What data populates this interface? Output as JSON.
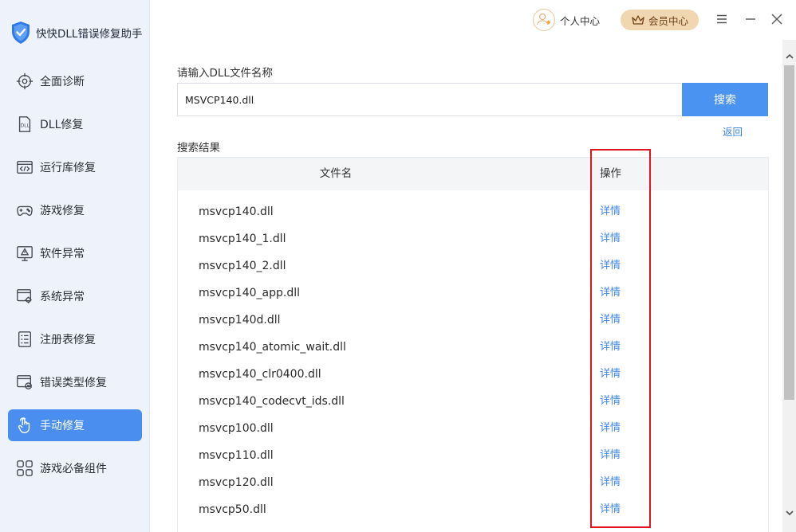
{
  "app": {
    "title": "快快DLL错误修复助手"
  },
  "sidebar": {
    "items": [
      {
        "label": "全面诊断",
        "icon": "target-icon",
        "active": false
      },
      {
        "label": "DLL修复",
        "icon": "dll-file-icon",
        "active": false
      },
      {
        "label": "运行库修复",
        "icon": "code-window-icon",
        "active": false
      },
      {
        "label": "游戏修复",
        "icon": "gamepad-icon",
        "active": false
      },
      {
        "label": "软件异常",
        "icon": "warning-monitor-icon",
        "active": false
      },
      {
        "label": "系统异常",
        "icon": "system-gear-icon",
        "active": false
      },
      {
        "label": "注册表修复",
        "icon": "registry-list-icon",
        "active": false
      },
      {
        "label": "错误类型修复",
        "icon": "error-window-icon",
        "active": false
      },
      {
        "label": "手动修复",
        "icon": "hand-pointer-icon",
        "active": true
      },
      {
        "label": "游戏必备组件",
        "icon": "grid-blocks-icon",
        "active": false
      }
    ]
  },
  "topbar": {
    "user_center": "个人中心",
    "vip_center": "会员中心"
  },
  "search": {
    "label": "请输入DLL文件名称",
    "value": "MSVCP140.dll",
    "button": "搜索",
    "back": "返回"
  },
  "results": {
    "label": "搜索结果",
    "columns": {
      "filename": "文件名",
      "action": "操作"
    },
    "rows": [
      {
        "name": "msvcp140.dll",
        "action": "详情"
      },
      {
        "name": "msvcp140_1.dll",
        "action": "详情"
      },
      {
        "name": "msvcp140_2.dll",
        "action": "详情"
      },
      {
        "name": "msvcp140_app.dll",
        "action": "详情"
      },
      {
        "name": "msvcp140d.dll",
        "action": "详情"
      },
      {
        "name": "msvcp140_atomic_wait.dll",
        "action": "详情"
      },
      {
        "name": "msvcp140_clr0400.dll",
        "action": "详情"
      },
      {
        "name": "msvcp140_codecvt_ids.dll",
        "action": "详情"
      },
      {
        "name": "msvcp100.dll",
        "action": "详情"
      },
      {
        "name": "msvcp110.dll",
        "action": "详情"
      },
      {
        "name": "msvcp120.dll",
        "action": "详情"
      },
      {
        "name": "msvcp50.dll",
        "action": "详情"
      }
    ]
  },
  "colors": {
    "accent": "#4a8ef0",
    "link": "#3f86e6",
    "highlight": "#e0141e",
    "sidebar_bg": "#eef3fb",
    "vip_bg": "#f1d6b2"
  }
}
